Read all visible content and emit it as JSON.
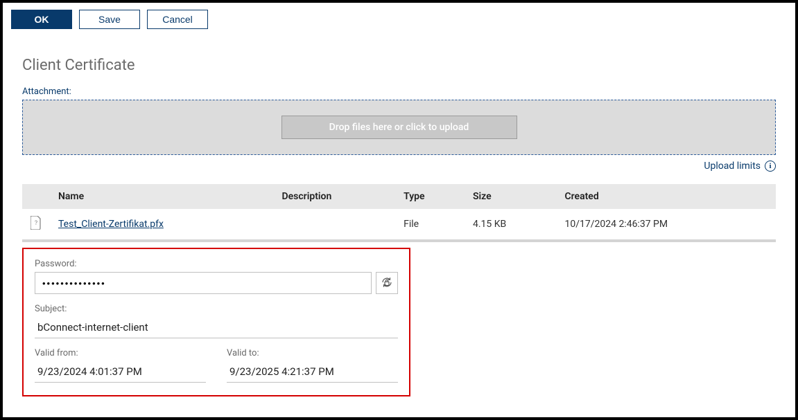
{
  "toolbar": {
    "ok_label": "OK",
    "save_label": "Save",
    "cancel_label": "Cancel"
  },
  "section": {
    "title": "Client Certificate",
    "attachment_label": "Attachment:",
    "dropzone_text": "Drop files here or click to upload",
    "upload_limits_label": "Upload limits"
  },
  "table": {
    "headers": {
      "name": "Name",
      "description": "Description",
      "type": "Type",
      "size": "Size",
      "created": "Created"
    },
    "row": {
      "name": "Test_Client-Zertifikat.pfx",
      "description": "",
      "type": "File",
      "size": "4.15 KB",
      "created": "10/17/2024 2:46:37 PM"
    }
  },
  "details": {
    "password_label": "Password:",
    "password_value": "••••••••••••••",
    "subject_label": "Subject:",
    "subject_value": "bConnect-internet-client",
    "valid_from_label": "Valid from:",
    "valid_from_value": "9/23/2024 4:01:37 PM",
    "valid_to_label": "Valid to:",
    "valid_to_value": "9/23/2025 4:21:37 PM"
  }
}
